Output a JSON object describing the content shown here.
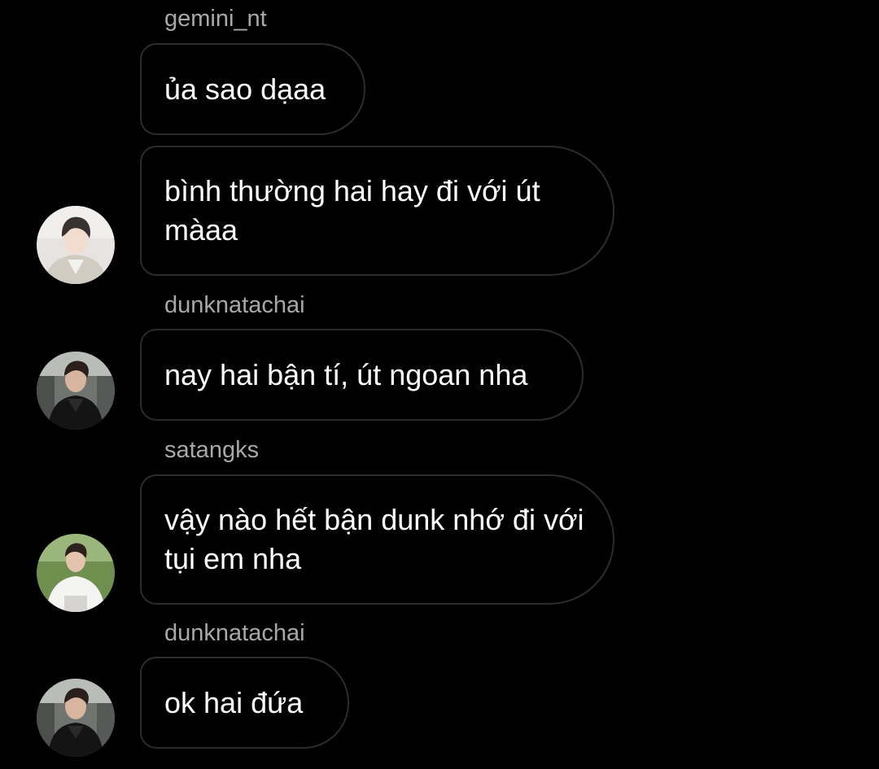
{
  "messages": [
    {
      "sender": "gemini_nt",
      "bubbles": [
        "ủa sao dạaa",
        "bình thường hai hay đi với út màaa"
      ]
    },
    {
      "sender": "dunknatachai",
      "bubbles": [
        "nay hai bận tí, út ngoan nha"
      ]
    },
    {
      "sender": "satangks",
      "bubbles": [
        "vậy nào hết bận dunk nhớ đi với tụi em nha"
      ]
    },
    {
      "sender": "dunknatachai",
      "bubbles": [
        "ok hai đứa"
      ]
    }
  ],
  "colors": {
    "background": "#000000",
    "bubble_border": "#2c2c2c",
    "message_text": "#ffffff",
    "username_text": "#a8a8a8"
  }
}
